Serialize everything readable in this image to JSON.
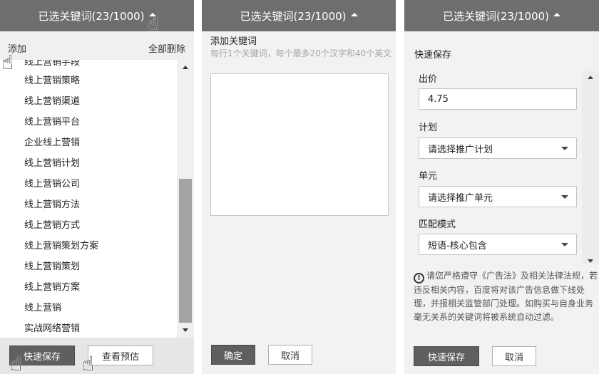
{
  "header": {
    "title": "已选关键词(23/1000)"
  },
  "panel_list": {
    "add_label": "添加",
    "delete_all_label": "全部删除",
    "partial_keyword": "线上营销手段",
    "keywords": [
      "线上营销策略",
      "线上营销渠道",
      "线上营销平台",
      "企业线上营销",
      "线上营销计划",
      "线上营销公司",
      "线上营销方法",
      "线上营销方式",
      "线上营销策划方案",
      "线上营销策划",
      "线上营销方案",
      "线上营销",
      "实战网络营销"
    ],
    "quick_save_label": "快速保存",
    "preview_label": "查看预估"
  },
  "panel_add": {
    "field_label": "添加关键词",
    "placeholder_hint": "每行1个关键词，每个最多20个汉字和40个英文",
    "textarea_value": "",
    "confirm_label": "确定",
    "cancel_label": "取消"
  },
  "panel_save": {
    "section_title": "快速保存",
    "bid_label": "出价",
    "bid_value": "4.75",
    "plan_label": "计划",
    "plan_value": "请选择推广计划",
    "unit_label": "单元",
    "unit_value": "请选择推广单元",
    "match_label": "匹配模式",
    "match_value": "短语-核心包含",
    "notice_icon": "exclamation-circle-icon",
    "notice_text": "请您严格遵守《广告法》及相关法律法规，若违反相关内容，百度将对该广告信息做下线处理，并报相关监管部门处理。如购买与自身业务毫无关系的关键词将被系统自动过滤。",
    "quick_save_label": "快速保存",
    "cancel_label": "取消"
  },
  "icons": [
    "caret-up-icon",
    "hand-cursor-icon",
    "scroll-up-icon",
    "scroll-down-icon",
    "dropdown-arrow-icon"
  ]
}
